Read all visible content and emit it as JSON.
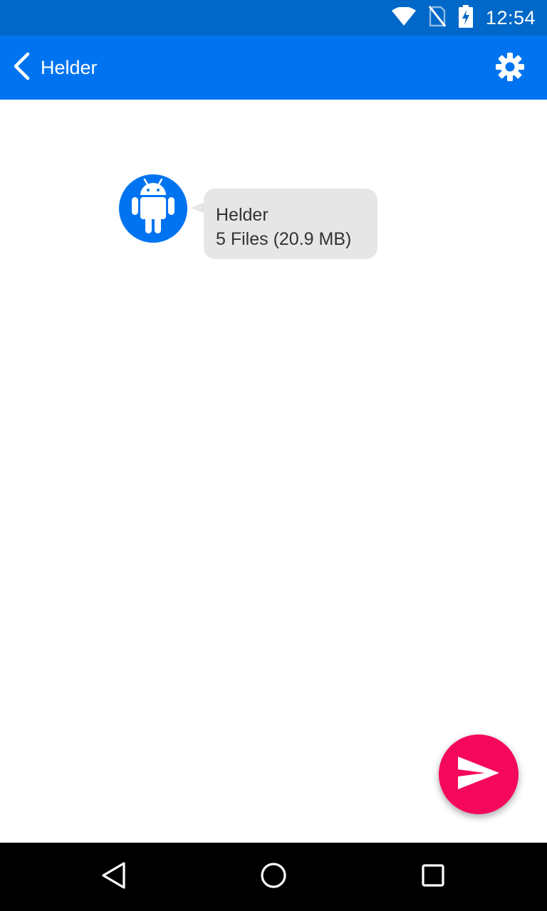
{
  "status_bar": {
    "time": "12:54",
    "icons": [
      "wifi-icon",
      "no-sim-icon",
      "battery-charging-icon"
    ]
  },
  "app_bar": {
    "title": "Helder",
    "back_icon": "chevron-left-icon",
    "settings_icon": "gear-icon"
  },
  "message": {
    "avatar_icon": "android-icon",
    "sender": "Helder",
    "summary": "5 Files (20.9 MB)"
  },
  "fab": {
    "icon": "send-icon"
  },
  "nav_bar": {
    "items": [
      "back-triangle-icon",
      "home-circle-icon",
      "recents-square-icon"
    ]
  },
  "colors": {
    "status_bar": "#0068c8",
    "app_bar": "#0074f0",
    "bubble": "#e6e6e6",
    "fab": "#f5075c",
    "nav_bar": "#000000"
  }
}
